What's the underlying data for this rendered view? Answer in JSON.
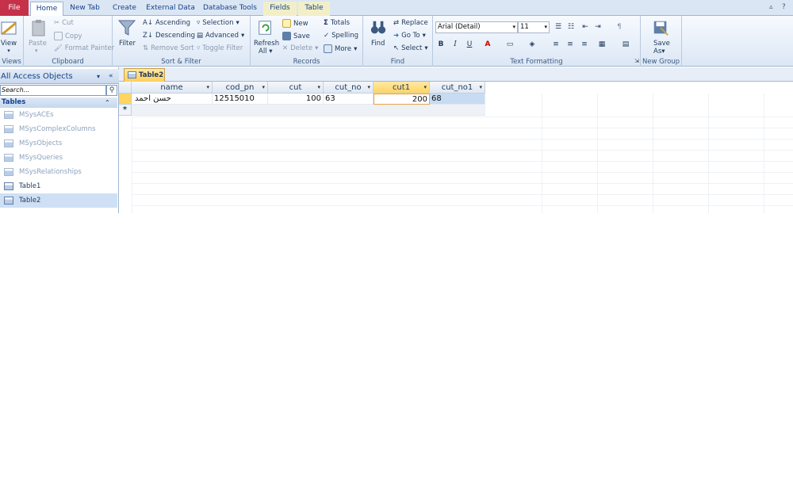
{
  "tabs": [
    "File",
    "Home",
    "New Tab",
    "Create",
    "External Data",
    "Database Tools",
    "Fields",
    "Table"
  ],
  "ribbon": {
    "views": {
      "view_label": "View",
      "group": "Views"
    },
    "clipboard": {
      "paste": "Paste",
      "cut": "Cut",
      "copy": "Copy",
      "format_painter": "Format Painter",
      "group": "Clipboard"
    },
    "sort_filter": {
      "filter": "Filter",
      "ascending": "Ascending",
      "descending": "Descending",
      "remove_sort": "Remove Sort",
      "selection": "Selection",
      "advanced": "Advanced",
      "toggle_filter": "Toggle Filter",
      "group": "Sort & Filter"
    },
    "records": {
      "refresh": "Refresh",
      "refresh2": "All",
      "new": "New",
      "save": "Save",
      "delete": "Delete",
      "totals": "Totals",
      "spelling": "Spelling",
      "more": "More",
      "group": "Records"
    },
    "find": {
      "find": "Find",
      "replace": "Replace",
      "goto": "Go To",
      "select": "Select",
      "group": "Find"
    },
    "text_formatting": {
      "font": "Arial (Detail)",
      "size": "11",
      "bold": "B",
      "italic": "I",
      "underline": "U",
      "group": "Text Formatting"
    },
    "new_group": {
      "save_as": "Save",
      "save_as2": "As",
      "group": "New Group"
    }
  },
  "nav": {
    "header": "All Access Objects",
    "search_placeholder": "Search...",
    "section": "Tables",
    "items": [
      "MSysACEs",
      "MSysComplexColumns",
      "MSysObjects",
      "MSysQueries",
      "MSysRelationships",
      "Table1",
      "Table2"
    ]
  },
  "document": {
    "tab": "Table2"
  },
  "datasheet": {
    "columns": [
      "name",
      "cod_pn",
      "cut",
      "cut_no",
      "cut1",
      "cut_no1"
    ],
    "row": {
      "name": "حسن احمد",
      "cod_pn": "12515010",
      "cut": "100",
      "cut_no": "63",
      "cut1": "200",
      "cut_no1": "68"
    },
    "new_row_marker": "*"
  },
  "colors": {
    "file_tab": "#c6314a",
    "active_column": "#ffd560",
    "selection": "#c7dcf3"
  }
}
